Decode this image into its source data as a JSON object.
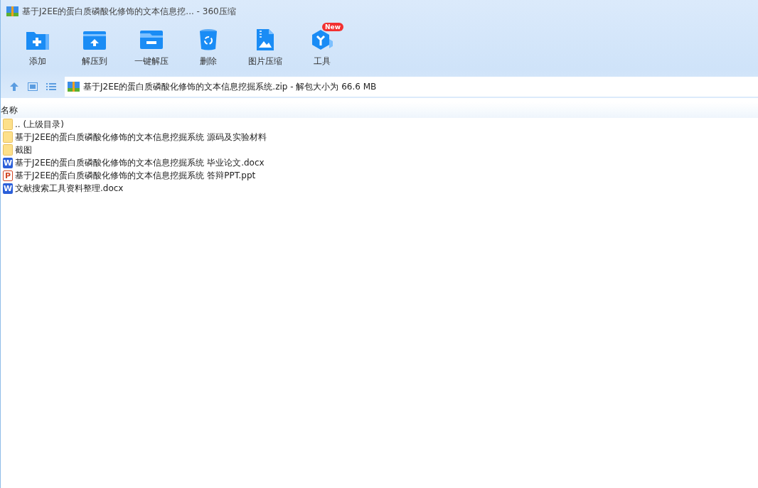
{
  "window": {
    "title": "基于J2EE的蛋白质磷酸化修饰的文本信息挖... - 360压缩"
  },
  "toolbar": [
    {
      "label": "添加",
      "kind": "add"
    },
    {
      "label": "解压到",
      "kind": "extract"
    },
    {
      "label": "一键解压",
      "kind": "oneclick"
    },
    {
      "label": "删除",
      "kind": "delete"
    },
    {
      "label": "图片压缩",
      "kind": "image"
    },
    {
      "label": "工具",
      "kind": "tools",
      "badge": "New"
    }
  ],
  "address": {
    "path": "基于J2EE的蛋白质磷酸化修饰的文本信息挖掘系统.zip - 解包大小为 66.6 MB"
  },
  "table": {
    "columns": [
      "名称"
    ],
    "rows": [
      {
        "name": ".. (上级目录)",
        "kind": "folder"
      },
      {
        "name": "基于J2EE的蛋白质磷酸化修饰的文本信息挖掘系统 源码及实验材料",
        "kind": "folder"
      },
      {
        "name": "截图",
        "kind": "folder"
      },
      {
        "name": "基于J2EE的蛋白质磷酸化修饰的文本信息挖掘系统 毕业论文.docx",
        "kind": "word",
        "icon_letter": "W"
      },
      {
        "name": "基于J2EE的蛋白质磷酸化修饰的文本信息挖掘系统 答辩PPT.ppt",
        "kind": "ppt",
        "icon_letter": "P"
      },
      {
        "name": "文献搜索工具资料整理.docx",
        "kind": "word",
        "icon_letter": "W"
      }
    ]
  }
}
